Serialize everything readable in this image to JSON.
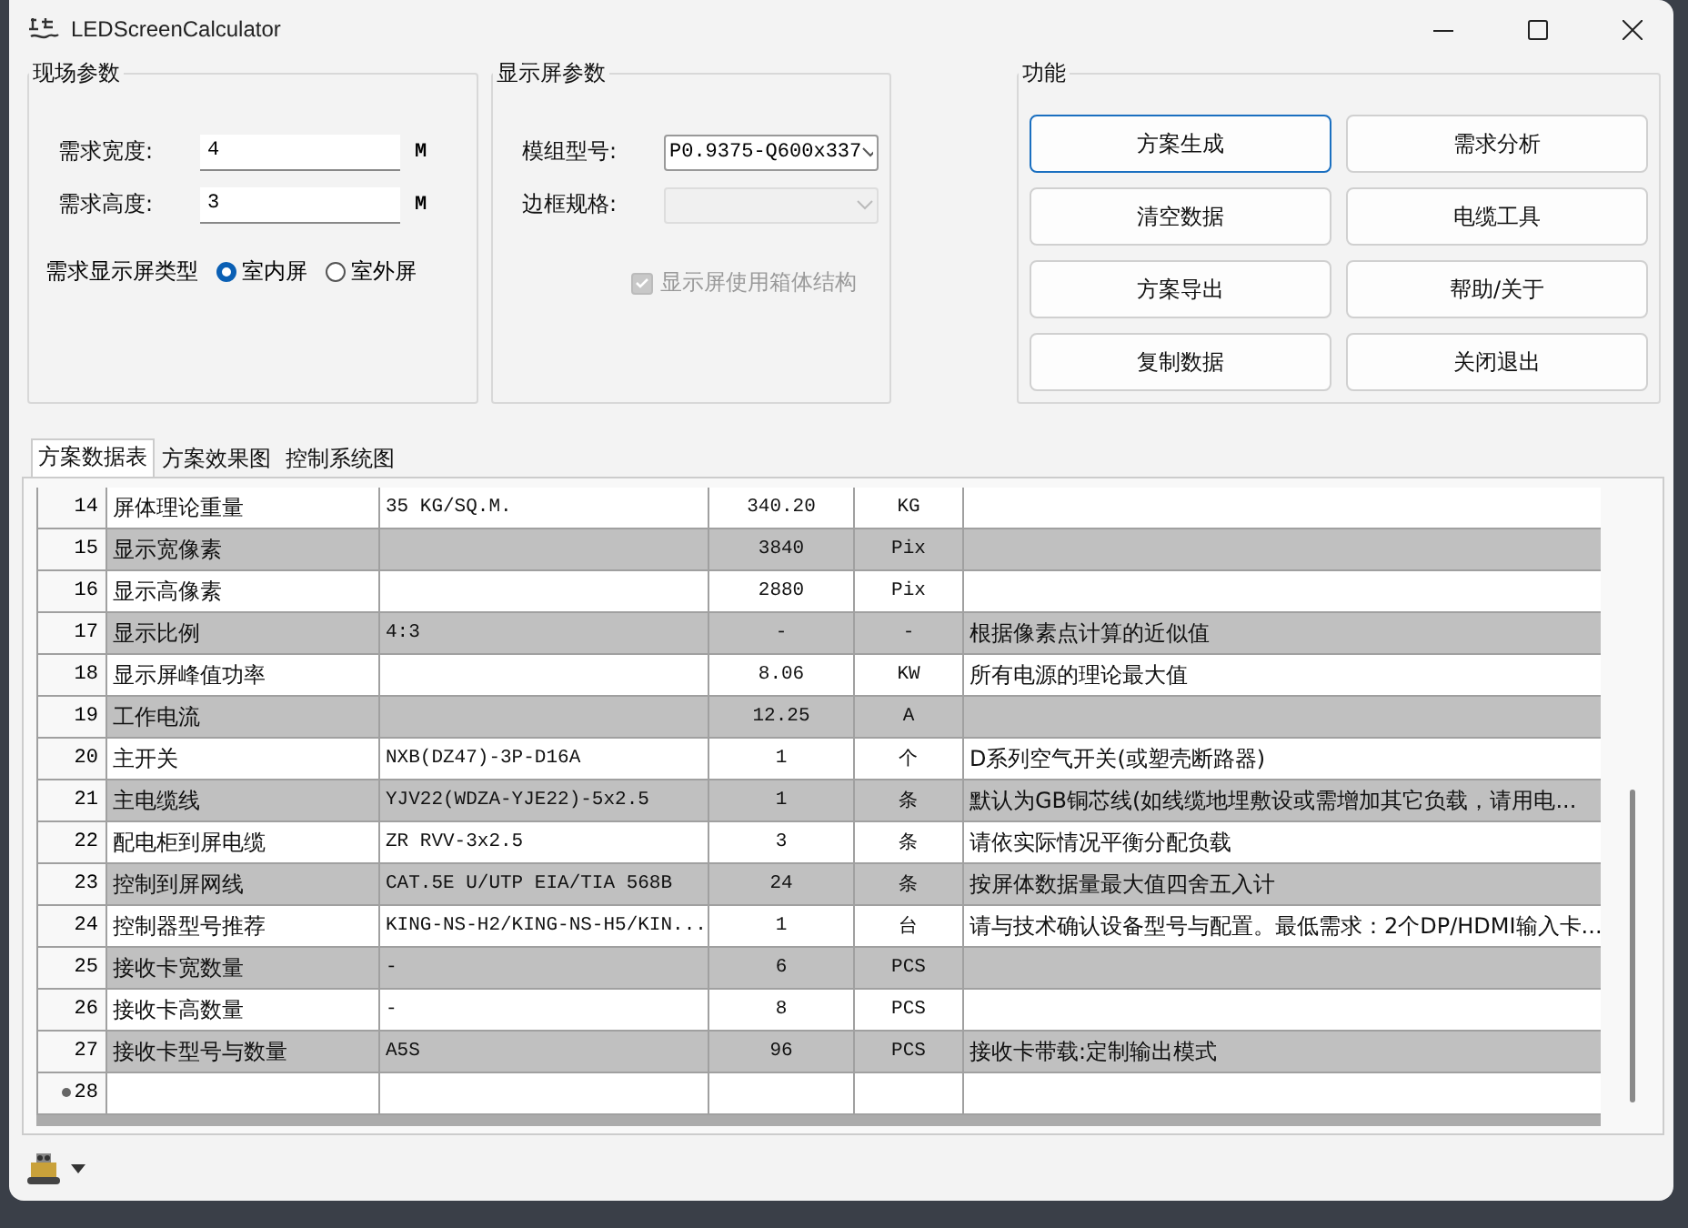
{
  "window": {
    "title": "LEDScreenCalculator"
  },
  "site_params": {
    "title": "现场参数",
    "fields": [
      {
        "label": "需求宽度:",
        "value": "4",
        "unit": "M"
      },
      {
        "label": "需求高度:",
        "value": "3",
        "unit": "M"
      }
    ],
    "type_label": "需求显示屏类型",
    "radios": [
      {
        "label": "室内屏",
        "selected": true
      },
      {
        "label": "室外屏",
        "selected": false
      }
    ]
  },
  "screen_params": {
    "title": "显示屏参数",
    "combos": [
      {
        "label": "模组型号:",
        "value": "P0.9375-Q600x337",
        "disabled": false
      },
      {
        "label": "边框规格:",
        "disabled": true
      }
    ],
    "checkbox": {
      "label": "显示屏使用箱体结构",
      "checked": true,
      "disabled": true
    }
  },
  "functions": {
    "title": "功能",
    "buttons": [
      {
        "label": "方案生成",
        "focused": true
      },
      {
        "label": "需求分析",
        "focused": false
      },
      {
        "label": "清空数据",
        "focused": false
      },
      {
        "label": "电缆工具",
        "focused": false
      },
      {
        "label": "方案导出",
        "focused": false
      },
      {
        "label": "帮助/关于",
        "focused": false
      },
      {
        "label": "复制数据",
        "focused": false
      },
      {
        "label": "关闭退出",
        "focused": false
      }
    ]
  },
  "tabs": [
    {
      "label": "方案数据表",
      "selected": true
    },
    {
      "label": "方案效果图",
      "selected": false
    },
    {
      "label": "控制系统图",
      "selected": false
    }
  ],
  "table": {
    "rows": [
      {
        "number": "14",
        "current": false,
        "cells": [
          "屏体理论重量",
          "35 KG/SQ.M.",
          "340.20",
          "KG",
          null
        ]
      },
      {
        "number": "15",
        "current": false,
        "cells": [
          "显示宽像素",
          null,
          "3840",
          "Pix",
          null
        ]
      },
      {
        "number": "16",
        "current": false,
        "cells": [
          "显示高像素",
          null,
          "2880",
          "Pix",
          null
        ]
      },
      {
        "number": "17",
        "current": false,
        "cells": [
          "显示比例",
          "4:3",
          "-",
          "-",
          "根据像素点计算的近似值"
        ]
      },
      {
        "number": "18",
        "current": false,
        "cells": [
          "显示屏峰值功率",
          null,
          "8.06",
          "KW",
          "所有电源的理论最大值"
        ]
      },
      {
        "number": "19",
        "current": false,
        "cells": [
          "工作电流",
          null,
          "12.25",
          "A",
          null
        ]
      },
      {
        "number": "20",
        "current": false,
        "cells": [
          "主开关",
          "NXB(DZ47)-3P-D16A",
          "1",
          "个",
          "D系列空气开关(或塑壳断路器)"
        ]
      },
      {
        "number": "21",
        "current": false,
        "cells": [
          "主电缆线",
          "YJV22(WDZA-YJE22)-5x2.5",
          "1",
          "条",
          "默认为GB铜芯线(如线缆地埋敷设或需增加其它负载，请用电..."
        ]
      },
      {
        "number": "22",
        "current": false,
        "cells": [
          "配电柜到屏电缆",
          "ZR RVV-3x2.5",
          "3",
          "条",
          "请依实际情况平衡分配负载"
        ]
      },
      {
        "number": "23",
        "current": false,
        "cells": [
          "控制到屏网线",
          "CAT.5E U/UTP EIA/TIA 568B",
          "24",
          "条",
          "按屏体数据量最大值四舍五入计"
        ]
      },
      {
        "number": "24",
        "current": false,
        "cells": [
          "控制器型号推荐",
          "KING-NS-H2/KING-NS-H5/KIN...",
          "1",
          "台",
          "请与技术确认设备型号与配置。最低需求：2个DP/HDMI输入卡..."
        ]
      },
      {
        "number": "25",
        "current": false,
        "cells": [
          "接收卡宽数量",
          "-",
          "6",
          "PCS",
          null
        ]
      },
      {
        "number": "26",
        "current": false,
        "cells": [
          "接收卡高数量",
          "-",
          "8",
          "PCS",
          null
        ]
      },
      {
        "number": "27",
        "current": false,
        "cells": [
          "接收卡型号与数量",
          "A5S",
          "96",
          "PCS",
          "接收卡带载:定制输出模式"
        ]
      },
      {
        "number": "28",
        "current": true,
        "cells": [
          null,
          null,
          null,
          null,
          null
        ]
      }
    ]
  }
}
